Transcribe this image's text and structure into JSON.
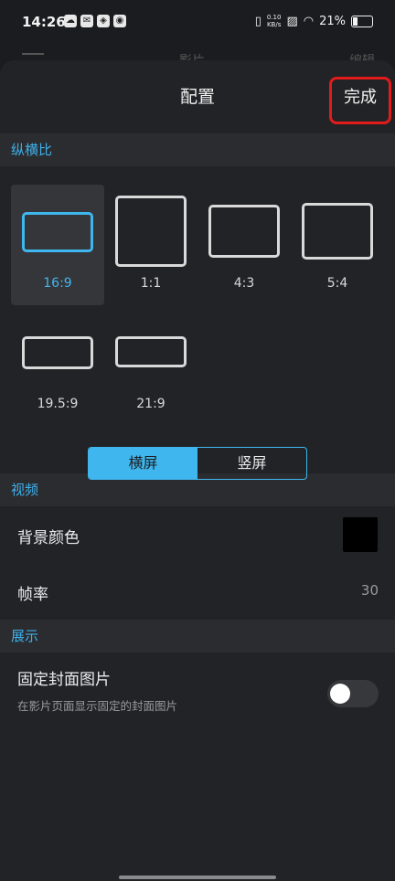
{
  "status_bar": {
    "time": "14:26",
    "net_speed_value": "0.10",
    "net_speed_unit": "KB/s",
    "battery": "21%"
  },
  "background_page": {
    "tab_1": "影片",
    "tab_2": "编辑"
  },
  "header": {
    "title": "配置",
    "done_label": "完成"
  },
  "aspect_section": {
    "title": "纵横比",
    "options": [
      {
        "label": "16:9",
        "selected": true
      },
      {
        "label": "1:1",
        "selected": false
      },
      {
        "label": "4:3",
        "selected": false
      },
      {
        "label": "5:4",
        "selected": false
      },
      {
        "label": "19.5:9",
        "selected": false
      },
      {
        "label": "21:9",
        "selected": false
      }
    ],
    "orientation": {
      "landscape": "横屏",
      "portrait": "竖屏",
      "selected": "landscape"
    }
  },
  "video_section": {
    "title": "视频",
    "background_color_label": "背景颜色",
    "background_color_value": "#000000",
    "frame_rate_label": "帧率",
    "frame_rate_value": "30"
  },
  "display_section": {
    "title": "展示",
    "fixed_cover_label": "固定封面图片",
    "fixed_cover_desc": "在影片页面显示固定的封面图片",
    "fixed_cover_enabled": false
  },
  "colors": {
    "accent": "#3fb7ee",
    "highlight": "#e21b1b",
    "background": "#222326"
  }
}
